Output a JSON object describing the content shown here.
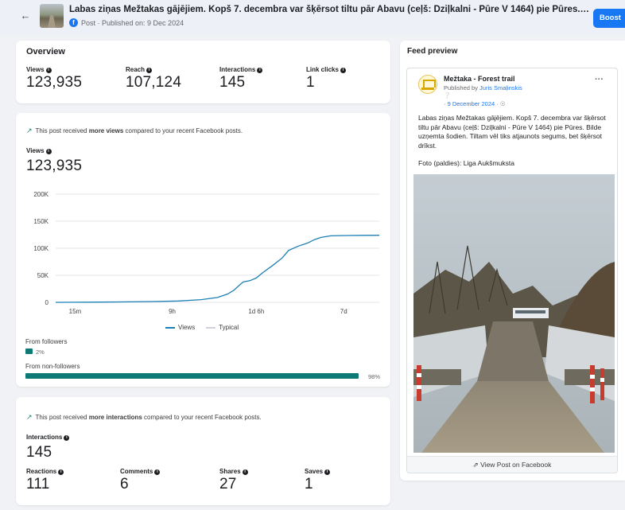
{
  "header": {
    "back_icon": "arrow-left-icon",
    "title": "Labas ziņas Mežtakas gājējiem. Kopš 7. decembra var šķērsot tiltu pār Abavu (ceļš: Dziļkalni - Pūre V 1464) pie Pūres. Bilde uzņemta šo...",
    "meta": "Post · Published on: 9 Dec 2024",
    "boost_label": "Boost"
  },
  "overview": {
    "title": "Overview",
    "metrics": [
      {
        "label": "Views",
        "value": "123,935"
      },
      {
        "label": "Reach",
        "value": "107,124"
      },
      {
        "label": "Interactions",
        "value": "145"
      },
      {
        "label": "Link clicks",
        "value": "1"
      }
    ]
  },
  "views_card": {
    "note_prefix": "This post received ",
    "note_bold": "more views",
    "note_suffix": " compared to your recent Facebook posts.",
    "label": "Views",
    "value": "123,935",
    "legend": [
      {
        "name": "Views",
        "color": "#1b7fb5"
      },
      {
        "name": "Typical",
        "color": "#cfd2d6"
      }
    ],
    "sources": [
      {
        "label": "From followers",
        "percent_label": "2%",
        "fraction": 0.02
      },
      {
        "label": "From non-followers",
        "percent_label": "98%",
        "fraction": 0.98
      }
    ]
  },
  "chart_data": {
    "type": "line",
    "title": "",
    "xlabel": "",
    "ylabel": "",
    "y_ticks": [
      "0",
      "50K",
      "100K",
      "150K",
      "200K"
    ],
    "y_tick_values": [
      0,
      50000,
      100000,
      150000,
      200000
    ],
    "ylim": [
      0,
      200000
    ],
    "x_ticks": [
      "15m",
      "9h",
      "1d 6h",
      "7d"
    ],
    "grid": true,
    "legend_position": "bottom",
    "series": [
      {
        "name": "Views",
        "x": [
          0,
          0.05,
          0.1,
          0.2,
          0.3,
          0.38,
          0.45,
          0.5,
          0.53,
          0.55,
          0.57,
          0.58,
          0.6,
          0.62,
          0.64,
          0.67,
          0.7,
          0.72,
          0.75,
          0.78,
          0.8,
          0.82,
          0.85,
          0.9,
          0.95,
          1.0
        ],
        "values": [
          0,
          100,
          300,
          800,
          1500,
          2500,
          5000,
          9000,
          15000,
          22000,
          33000,
          38000,
          40000,
          45000,
          55000,
          68000,
          82000,
          96000,
          104000,
          110000,
          116000,
          120000,
          123000,
          123500,
          123800,
          123935
        ]
      }
    ]
  },
  "interactions_card": {
    "note_prefix": "This post received ",
    "note_bold": "more interactions",
    "note_suffix": " compared to your recent Facebook posts.",
    "label": "Interactions",
    "value": "145",
    "metrics": [
      {
        "label": "Reactions",
        "value": "111"
      },
      {
        "label": "Comments",
        "value": "6"
      },
      {
        "label": "Shares",
        "value": "27"
      },
      {
        "label": "Saves",
        "value": "1"
      }
    ]
  },
  "feed_preview": {
    "title": "Feed preview",
    "page_name": "Mežtaka - Forest trail",
    "published_by_prefix": "Published by ",
    "published_by_name": "Juris Smaļinskis",
    "date": "· 9 December 2024 ·",
    "text": "Labas ziņas Mežtakas gājējiem. Kopš 7. decembra var šķērsot tiltu pār Abavu (ceļš: Dziļkalni - Pūre V 1464) pie Pūres. Bilde uzņemta šodien. Tiltam vēl tiks atjaunots segums, bet šķērsot drīkst.",
    "credit": "Foto (paldies): Liga Aukšmuksta",
    "view_button": "View Post on Facebook"
  }
}
